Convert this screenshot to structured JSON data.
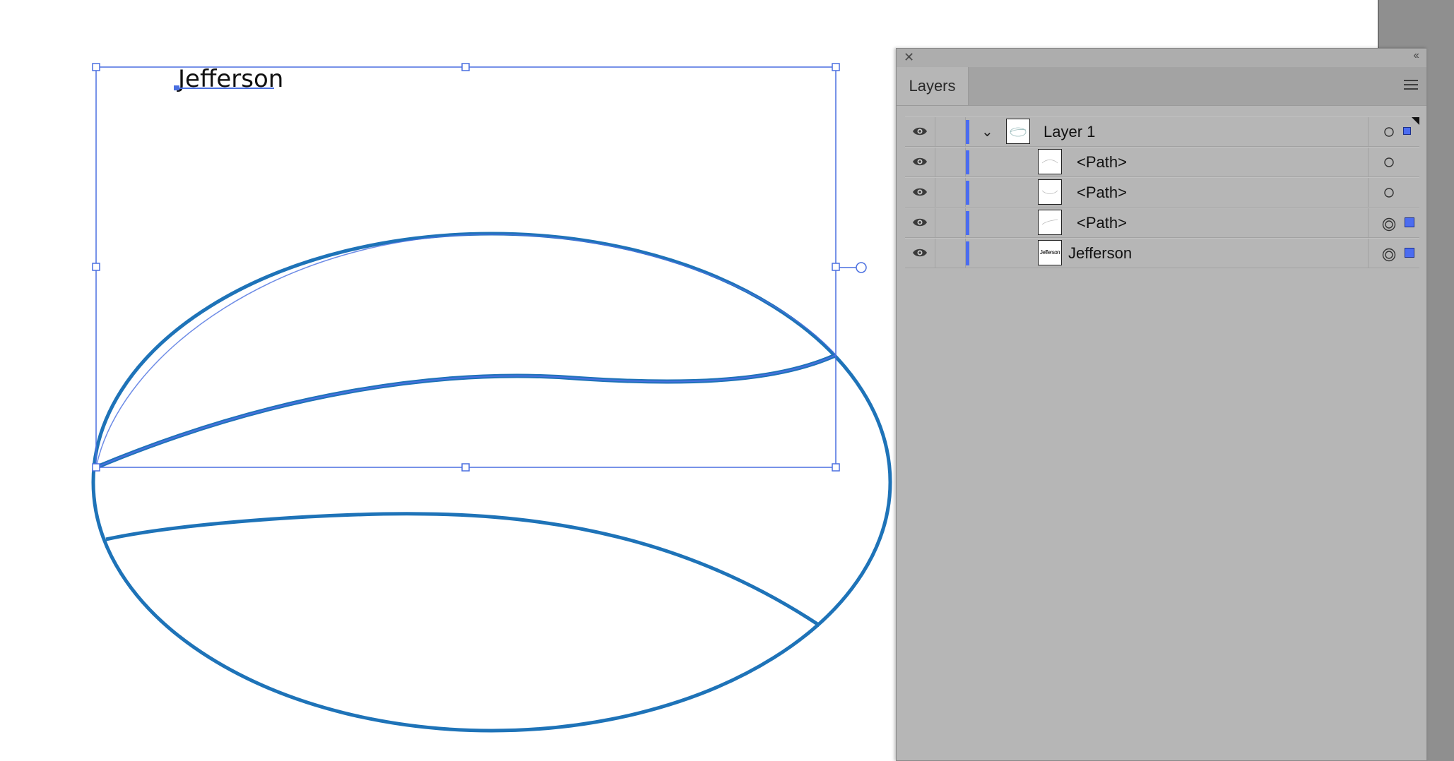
{
  "canvas": {
    "text_object": "Jefferson",
    "stroke_color": "#1e73b8",
    "selection_color": "#4a6fe0"
  },
  "panel": {
    "tab": "Layers",
    "close_icon": "close-icon",
    "collapse_icon": "double-chevron-left-icon",
    "menu_icon": "hamburger-menu-icon",
    "layer_color": "#4b6cf0",
    "rows": [
      {
        "label": "Layer 1",
        "type": "layer",
        "expanded": true,
        "target": "single",
        "selected": true
      },
      {
        "label": "<Path>",
        "type": "item",
        "target": "single",
        "selected": false
      },
      {
        "label": "<Path>",
        "type": "item",
        "target": "single",
        "selected": false
      },
      {
        "label": "<Path>",
        "type": "item",
        "target": "double",
        "selected": true
      },
      {
        "label": "Jefferson",
        "type": "text-item",
        "target": "double",
        "selected": true,
        "thumb_text": "Jefferson"
      }
    ]
  }
}
